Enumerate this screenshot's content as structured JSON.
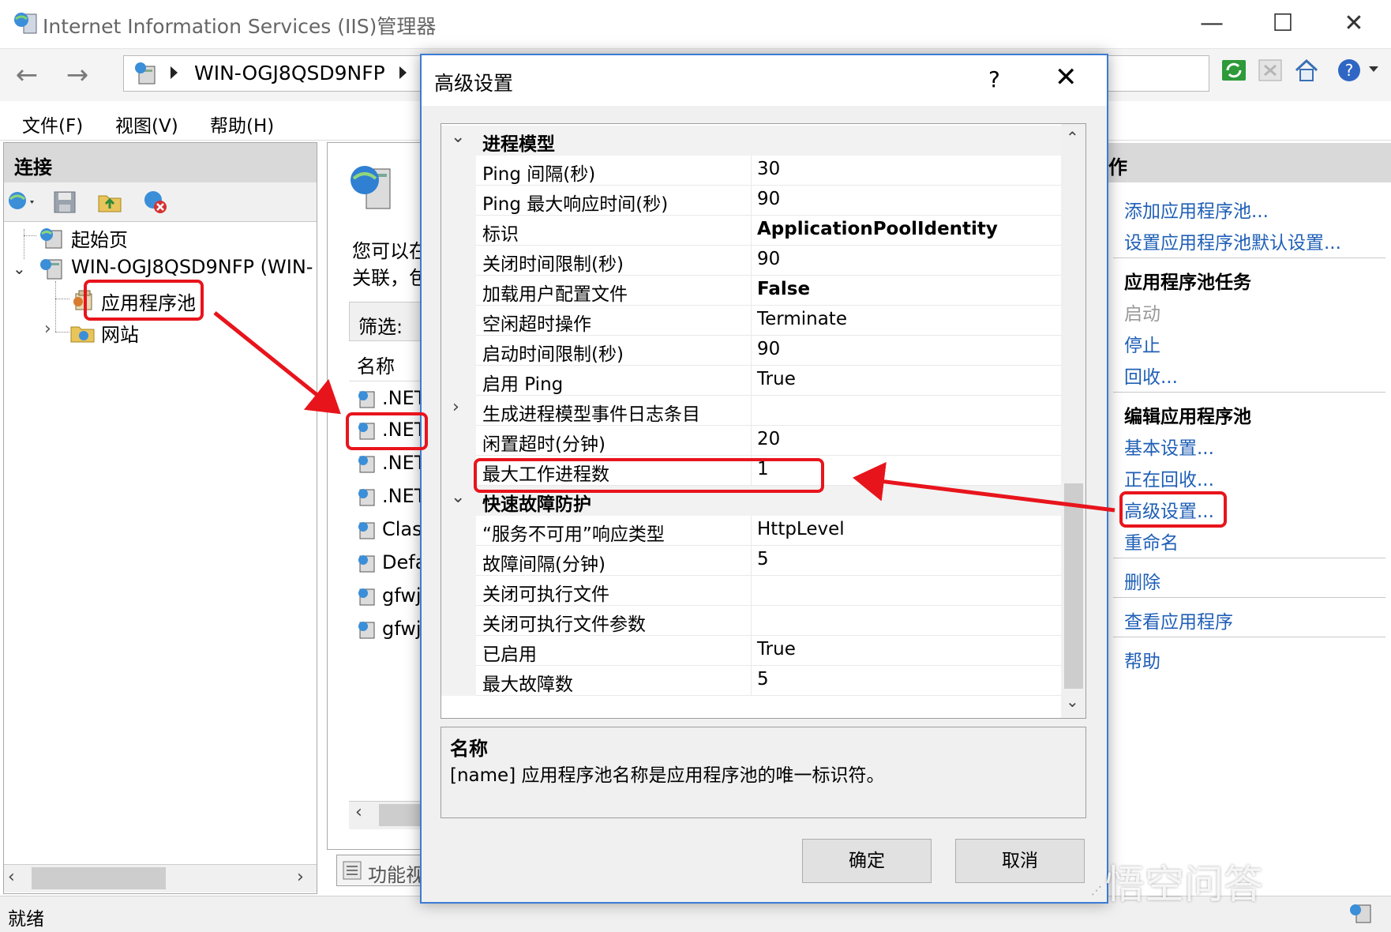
{
  "window": {
    "title": "Internet Information Services (IIS)管理器"
  },
  "address": {
    "crumb": "WIN-OGJ8QSD9NFP"
  },
  "menu": [
    "文件(F)",
    "视图(V)",
    "帮助(H)"
  ],
  "connections": {
    "title": "连接",
    "tree": {
      "start_page": "起始页",
      "server": "WIN-OGJ8QSD9NFP (WIN-",
      "app_pools": "应用程序池",
      "sites": "网站"
    }
  },
  "center": {
    "intro_line1": "您可以在",
    "intro_line2": "关联，包",
    "filter_label": "筛选:",
    "column_name": "名称",
    "rows": [
      ".NET",
      ".NET",
      ".NET",
      ".NET",
      "Clas",
      "Defa",
      "gfwj",
      "gfwj"
    ],
    "bottom_tab": "功能视"
  },
  "actions": {
    "title": "作",
    "top_links": [
      "添加应用程序池...",
      "设置应用程序池默认设置..."
    ],
    "tasks_title": "应用程序池任务",
    "task_start": "启动",
    "task_stop": "停止",
    "task_recycle": "回收...",
    "edit_title": "编辑应用程序池",
    "edit_links": [
      "基本设置...",
      "正在回收...",
      "高级设置...",
      "重命名"
    ],
    "delete": "删除",
    "view_apps": "查看应用程序",
    "help": "帮助"
  },
  "status": {
    "text": "就绪"
  },
  "dialog": {
    "title": "高级设置",
    "help_glyph": "?",
    "close_glyph": "✕",
    "categories": [
      {
        "name": "进程模型",
        "rows": [
          {
            "name": "Ping 间隔(秒)",
            "value": "30",
            "bold": false
          },
          {
            "name": "Ping 最大响应时间(秒)",
            "value": "90",
            "bold": false
          },
          {
            "name": "标识",
            "value": "ApplicationPoolIdentity",
            "bold": true
          },
          {
            "name": "关闭时间限制(秒)",
            "value": "90",
            "bold": false
          },
          {
            "name": "加载用户配置文件",
            "value": "False",
            "bold": true
          },
          {
            "name": "空闲超时操作",
            "value": "Terminate",
            "bold": false
          },
          {
            "name": "启动时间限制(秒)",
            "value": "90",
            "bold": false
          },
          {
            "name": "启用 Ping",
            "value": "True",
            "bold": false
          },
          {
            "name": "生成进程模型事件日志条目",
            "value": "",
            "bold": false,
            "expandable": true
          },
          {
            "name": "闲置超时(分钟)",
            "value": "20",
            "bold": false
          },
          {
            "name": "最大工作进程数",
            "value": "1",
            "bold": false
          }
        ]
      },
      {
        "name": "快速故障防护",
        "rows": [
          {
            "name": "“服务不可用”响应类型",
            "value": "HttpLevel",
            "bold": false
          },
          {
            "name": "故障间隔(分钟)",
            "value": "5",
            "bold": false
          },
          {
            "name": "关闭可执行文件",
            "value": "",
            "bold": false
          },
          {
            "name": "关闭可执行文件参数",
            "value": "",
            "bold": false
          },
          {
            "name": "已启用",
            "value": "True",
            "bold": false
          },
          {
            "name": "最大故障数",
            "value": "5",
            "bold": false
          }
        ]
      }
    ],
    "description": {
      "title": "名称",
      "text": "[name] 应用程序池名称是应用程序池的唯一标识符。"
    },
    "ok": "确定",
    "cancel": "取消"
  },
  "watermark": "悟空问答",
  "colors": {
    "annotation_red": "#e8141c",
    "link_blue": "#1f5fb6",
    "dialog_border": "#3b7bd4"
  }
}
